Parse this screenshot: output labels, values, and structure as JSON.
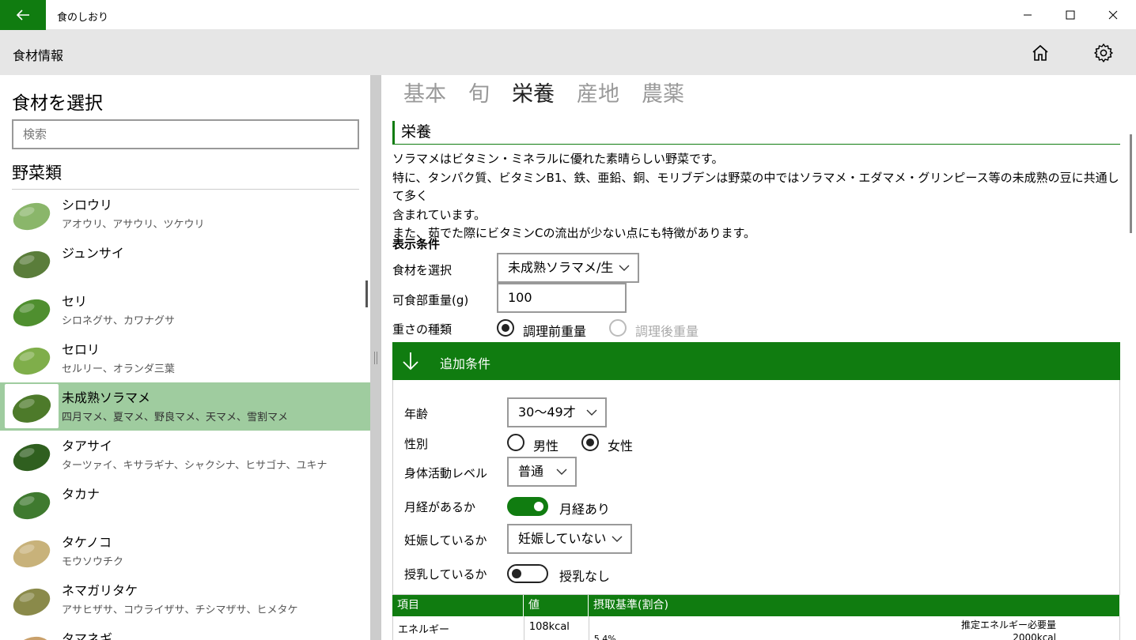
{
  "titlebar": {
    "app_title": "食のしおり"
  },
  "header": {
    "title": "食材情報"
  },
  "left": {
    "title": "食材を選択",
    "search_placeholder": "検索",
    "category": "野菜類",
    "items": [
      {
        "name": "シロウリ",
        "sub": "アオウリ、アサウリ、ツケウリ",
        "selected": false,
        "color": "#8ab66a"
      },
      {
        "name": "ジュンサイ",
        "sub": "",
        "selected": false,
        "color": "#5a7d3a"
      },
      {
        "name": "セリ",
        "sub": "シロネグサ、カワナグサ",
        "selected": false,
        "color": "#4f8f2f"
      },
      {
        "name": "セロリ",
        "sub": "セルリー、オランダ三葉",
        "selected": false,
        "color": "#7fae4a"
      },
      {
        "name": "未成熟ソラマメ",
        "sub": "四月マメ、夏マメ、野良マメ、天マメ、雪割マメ",
        "selected": true,
        "color": "#4d7a2a"
      },
      {
        "name": "タアサイ",
        "sub": "ターツァイ、キサラギナ、シャクシナ、ヒサゴナ、ユキナ",
        "selected": false,
        "color": "#2f5f1f"
      },
      {
        "name": "タカナ",
        "sub": "",
        "selected": false,
        "color": "#3f7a2f"
      },
      {
        "name": "タケノコ",
        "sub": "モウソウチク",
        "selected": false,
        "color": "#c8b27a"
      },
      {
        "name": "ネマガリタケ",
        "sub": "アサヒザサ、コウライザサ、チシマザサ、ヒメタケ",
        "selected": false,
        "color": "#8a8a4a"
      },
      {
        "name": "タマネギ",
        "sub": "",
        "selected": false,
        "color": "#c9a06a"
      }
    ]
  },
  "pivot": {
    "tabs": [
      "基本",
      "旬",
      "栄養",
      "産地",
      "農薬"
    ],
    "active_index": 2
  },
  "section": {
    "title": "栄養",
    "desc_lines": [
      "ソラマメはビタミン・ミネラルに優れた素晴らしい野菜です。",
      "特に、タンパク質、ビタミンB1、鉄、亜鉛、銅、モリブデンは野菜の中ではソラマメ・エダマメ・グリンピース等の未成熟の豆に共通して多く",
      "含まれています。",
      "また、茹でた際にビタミンCの流出が少ない点にも特徴があります。"
    ]
  },
  "conditions": {
    "title": "表示条件",
    "food_label": "食材を選択",
    "food_value": "未成熟ソラマメ/生",
    "weight_label": "可食部重量(g)",
    "weight_value": "100",
    "weight_type_label": "重さの種類",
    "weight_type_options": [
      "調理前重量",
      "調理後重量"
    ]
  },
  "extra": {
    "header": "追加条件",
    "age_label": "年齢",
    "age_value": "30〜49才",
    "sex_label": "性別",
    "sex_options": [
      "男性",
      "女性"
    ],
    "activity_label": "身体活動レベル",
    "activity_value": "普通",
    "menstruation_label": "月経があるか",
    "menstruation_state": "月経あり",
    "pregnancy_label": "妊娠しているか",
    "pregnancy_value": "妊娠していない",
    "lactation_label": "授乳しているか",
    "lactation_state": "授乳なし"
  },
  "table": {
    "headers": [
      "項目",
      "値",
      "摂取基準(割合)"
    ],
    "rows": [
      {
        "item": "エネルギー",
        "value": "108kcal",
        "ref_label": "推定エネルギー必要量",
        "ref_value": "2000kcal",
        "ratio": "5.4%"
      }
    ]
  },
  "colors": {
    "accent": "#107c10",
    "selected_bg": "#9fcc9f",
    "header_bg": "#e6e6e6"
  }
}
